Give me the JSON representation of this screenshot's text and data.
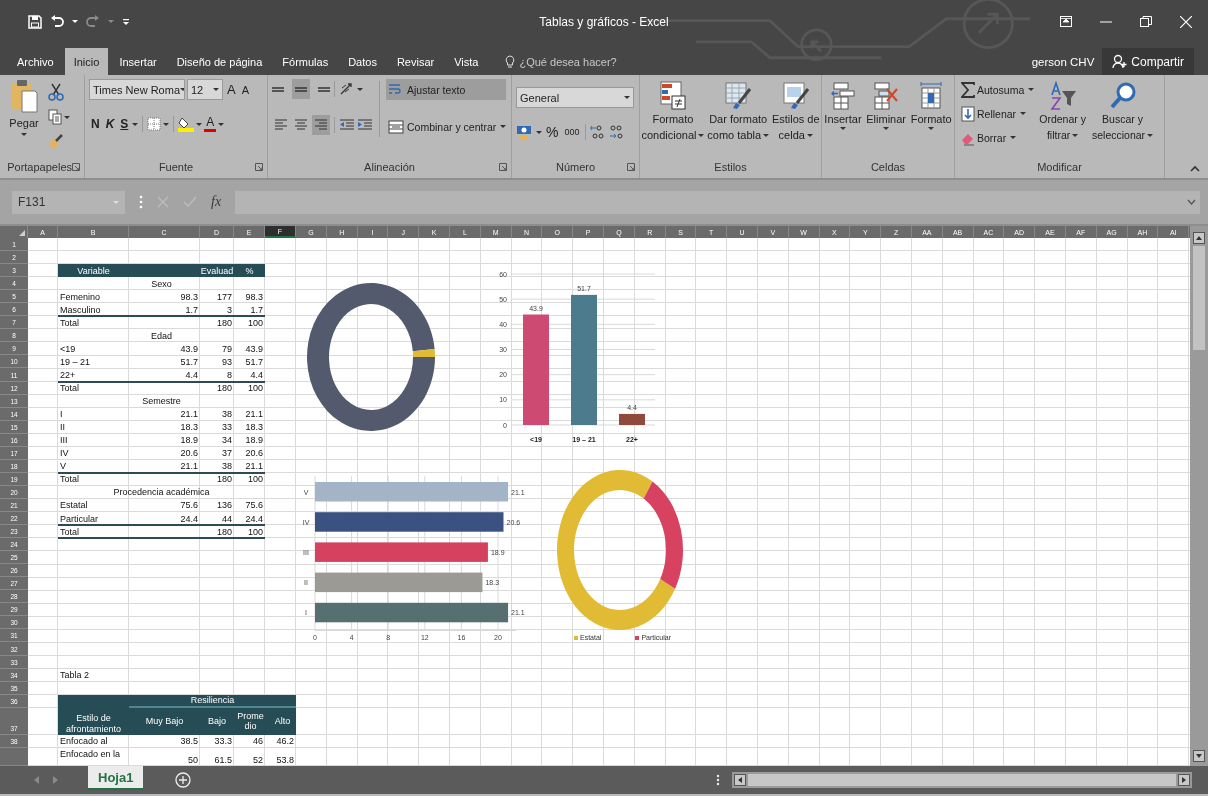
{
  "window": {
    "title": "Tablas y gráficos - Excel"
  },
  "ribbon_tabs": [
    {
      "label": "Archivo",
      "selected": false
    },
    {
      "label": "Inicio",
      "selected": true
    },
    {
      "label": "Insertar",
      "selected": false
    },
    {
      "label": "Diseño de página",
      "selected": false
    },
    {
      "label": "Fórmulas",
      "selected": false
    },
    {
      "label": "Datos",
      "selected": false
    },
    {
      "label": "Revisar",
      "selected": false
    },
    {
      "label": "Vista",
      "selected": false
    }
  ],
  "tell_me": {
    "placeholder": "¿Qué desea hacer?"
  },
  "account": {
    "user": "gerson CHV",
    "share": "Compartir"
  },
  "ribbon": {
    "clipboard": {
      "label": "Portapapeles",
      "paste": "Pegar"
    },
    "font": {
      "label": "Fuente",
      "family": "Times New Roma",
      "size": "12",
      "grow": "A",
      "shrink": "A",
      "bold": "N",
      "italic": "K",
      "underline": "S",
      "color_button": "A"
    },
    "alignment": {
      "label": "Alineación",
      "vertical": [
        {
          "selected": false
        },
        {
          "selected": true
        },
        {
          "selected": false
        }
      ],
      "horizontal": [
        {
          "selected": false
        },
        {
          "selected": false
        },
        {
          "selected": true
        }
      ],
      "wrap_text": {
        "label": "Ajustar texto",
        "on": true
      },
      "merge": "Combinar y centrar"
    },
    "number": {
      "label": "Número",
      "format": "General",
      "percent": "%",
      "thousands": "000"
    },
    "styles": {
      "label": "Estilos",
      "items": [
        {
          "line1": "Formato",
          "line2": "condicional"
        },
        {
          "line1": "Dar formato",
          "line2": "como tabla"
        },
        {
          "line1": "Estilos de",
          "line2": "celda"
        }
      ]
    },
    "cells": {
      "label": "Celdas",
      "items": [
        "Insertar",
        "Eliminar",
        "Formato"
      ]
    },
    "editing": {
      "label": "Modificar",
      "small": [
        "Autosuma",
        "Rellenar",
        "Borrar"
      ],
      "large": [
        {
          "line1": "Ordenar y",
          "line2": "filtrar"
        },
        {
          "line1": "Buscar y",
          "line2": "seleccionar"
        }
      ]
    }
  },
  "formula_bar": {
    "name_box": "F131",
    "function_label": "fx"
  },
  "columns": [
    {
      "label": "A",
      "selected": false
    },
    {
      "label": "B",
      "selected": false
    },
    {
      "label": "C",
      "selected": false
    },
    {
      "label": "D",
      "selected": false
    },
    {
      "label": "E",
      "selected": false
    },
    {
      "label": "F",
      "selected": true
    },
    {
      "label": "G",
      "selected": false
    },
    {
      "label": "H",
      "selected": false
    },
    {
      "label": "I",
      "selected": false
    },
    {
      "label": "J",
      "selected": false
    },
    {
      "label": "K",
      "selected": false
    },
    {
      "label": "L",
      "selected": false
    },
    {
      "label": "M",
      "selected": false
    },
    {
      "label": "N",
      "selected": false
    },
    {
      "label": "O",
      "selected": false
    },
    {
      "label": "P",
      "selected": false
    },
    {
      "label": "Q",
      "selected": false
    },
    {
      "label": "R",
      "selected": false
    },
    {
      "label": "S",
      "selected": false
    },
    {
      "label": "T",
      "selected": false
    },
    {
      "label": "U",
      "selected": false
    },
    {
      "label": "V",
      "selected": false
    },
    {
      "label": "W",
      "selected": false
    },
    {
      "label": "X",
      "selected": false
    },
    {
      "label": "Y",
      "selected": false
    },
    {
      "label": "Z",
      "selected": false
    },
    {
      "label": "AA",
      "selected": false
    },
    {
      "label": "AB",
      "selected": false
    },
    {
      "label": "AC",
      "selected": false
    },
    {
      "label": "AD",
      "selected": false
    },
    {
      "label": "AE",
      "selected": false
    },
    {
      "label": "AF",
      "selected": false
    },
    {
      "label": "AG",
      "selected": false
    },
    {
      "label": "AH",
      "selected": false
    },
    {
      "label": "AI",
      "selected": false
    }
  ],
  "rows": [
    {
      "n": "1",
      "kind": "empty"
    },
    {
      "n": "2",
      "kind": "empty"
    },
    {
      "n": "3",
      "kind": "header",
      "label": "Variable",
      "d": "Evaluad",
      "e": "%"
    },
    {
      "n": "4",
      "kind": "section",
      "title": "Sexo"
    },
    {
      "n": "5",
      "kind": "data",
      "label": "Femenino",
      "c": "98.3",
      "d": "177",
      "e": "98.3",
      "rule": false
    },
    {
      "n": "6",
      "kind": "data",
      "label": "Masculino",
      "c": "1.7",
      "d": "3",
      "e": "1.7",
      "rule": true
    },
    {
      "n": "7",
      "kind": "total",
      "label": "Total",
      "d": "180",
      "e": "100",
      "rule": false
    },
    {
      "n": "8",
      "kind": "section",
      "title": "Edad"
    },
    {
      "n": "9",
      "kind": "data",
      "label": "<19",
      "c": "43.9",
      "d": "79",
      "e": "43.9",
      "rule": false
    },
    {
      "n": "10",
      "kind": "data",
      "label": "19 – 21",
      "c": "51.7",
      "d": "93",
      "e": "51.7",
      "rule": false
    },
    {
      "n": "11",
      "kind": "data",
      "label": "22+",
      "c": "4.4",
      "d": "8",
      "e": "4.4",
      "rule": true
    },
    {
      "n": "12",
      "kind": "total",
      "label": "Total",
      "d": "180",
      "e": "100",
      "rule": false
    },
    {
      "n": "13",
      "kind": "section",
      "title": "Semestre"
    },
    {
      "n": "14",
      "kind": "data",
      "label": "I",
      "c": "21.1",
      "d": "38",
      "e": "21.1",
      "rule": false
    },
    {
      "n": "15",
      "kind": "data",
      "label": "II",
      "c": "18.3",
      "d": "33",
      "e": "18.3",
      "rule": false
    },
    {
      "n": "16",
      "kind": "data",
      "label": "III",
      "c": "18.9",
      "d": "34",
      "e": "18.9",
      "rule": false
    },
    {
      "n": "17",
      "kind": "data",
      "label": "IV",
      "c": "20.6",
      "d": "37",
      "e": "20.6",
      "rule": false
    },
    {
      "n": "18",
      "kind": "data",
      "label": "V",
      "c": "21.1",
      "d": "38",
      "e": "21.1",
      "rule": true
    },
    {
      "n": "19",
      "kind": "total",
      "label": "Total",
      "d": "180",
      "e": "100",
      "rule": false
    },
    {
      "n": "20",
      "kind": "section",
      "title": "Procedencia académica"
    },
    {
      "n": "21",
      "kind": "data",
      "label": "Estatal",
      "c": "75.6",
      "d": "136",
      "e": "75.6",
      "rule": false
    },
    {
      "n": "22",
      "kind": "data",
      "label": "Particular",
      "c": "24.4",
      "d": "44",
      "e": "24.4",
      "rule": true
    },
    {
      "n": "23",
      "kind": "total",
      "label": "Total",
      "d": "180",
      "e": "100",
      "rule": true
    },
    {
      "n": "24",
      "kind": "empty"
    },
    {
      "n": "25",
      "kind": "empty"
    },
    {
      "n": "26",
      "kind": "empty"
    },
    {
      "n": "27",
      "kind": "empty"
    },
    {
      "n": "28",
      "kind": "empty"
    },
    {
      "n": "29",
      "kind": "empty"
    },
    {
      "n": "30",
      "kind": "empty"
    },
    {
      "n": "31",
      "kind": "empty"
    },
    {
      "n": "32",
      "kind": "empty"
    },
    {
      "n": "33",
      "kind": "empty"
    },
    {
      "n": "34",
      "kind": "caption",
      "label": "Tabla 2"
    },
    {
      "n": "35",
      "kind": "empty"
    },
    {
      "n": "36",
      "kind": "group_header",
      "title": "Resiliencia"
    },
    {
      "n": "37",
      "kind": "subheader",
      "label": "Estilo de afrontamiento",
      "c": "Muy Bajo",
      "d": "Bajo",
      "e": "Promedio",
      "f": "Alto"
    },
    {
      "n": "38",
      "kind": "row",
      "label": "Enfocado al",
      "c": "38.5",
      "d": "33.3",
      "e": "46",
      "f": "46.2"
    },
    {
      "kind": "row_tall",
      "label": "Enfocado en la",
      "c": "50",
      "d": "61.5",
      "e": "52",
      "f": "53.8"
    }
  ],
  "charts": {
    "age_bar": {
      "chart_data": {
        "type": "bar",
        "categories": [
          "<19",
          "19 – 21",
          "22+"
        ],
        "series": [
          {
            "values": [
              43.9,
              51.7,
              4.4
            ]
          }
        ],
        "ylim": [
          0,
          60
        ],
        "yticks": [
          0,
          10,
          20,
          30,
          40,
          50,
          60
        ],
        "grid": true,
        "data_labels": true
      }
    },
    "semester_bar": {
      "chart_data": {
        "type": "bar",
        "orientation": "horizontal",
        "categories": [
          "V",
          "IV",
          "III",
          "II",
          "I"
        ],
        "series": [
          {
            "values": [
              21.1,
              20.6,
              18.9,
              18.3,
              21.1
            ]
          }
        ],
        "xlim": [
          0,
          22
        ],
        "xticks": [
          0,
          4,
          8,
          12,
          16,
          20
        ],
        "grid": true,
        "data_labels": true
      }
    },
    "origin_donut": {
      "legend": [
        {
          "label": "Estatal",
          "color": "#e2bb35"
        },
        {
          "label": "Particular",
          "color": "#d6425f"
        }
      ]
    }
  },
  "sheet_tabs": [
    {
      "label": "Hoja1",
      "selected": true
    }
  ]
}
